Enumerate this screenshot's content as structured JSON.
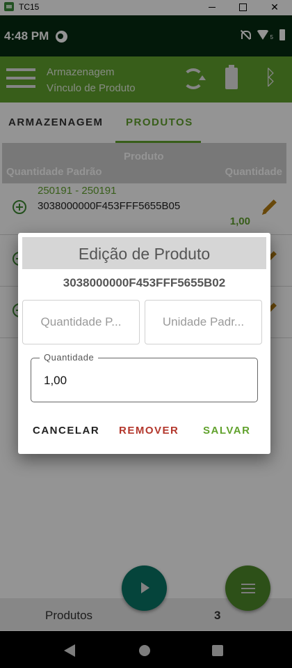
{
  "window": {
    "title": "TC15",
    "close_glyph": "✕"
  },
  "status": {
    "time": "4:48 PM",
    "wifi_badge": "5"
  },
  "toolbar": {
    "title": "Armazenagem",
    "subtitle": "Vínculo de Produto",
    "icons": [
      "menu-icon",
      "sync-icon",
      "battery-icon",
      "bluetooth-icon"
    ],
    "bluetooth_glyph": "ᛒ",
    "color": "#61a22d"
  },
  "tabs": [
    {
      "label": "ARMAZENAGEM",
      "selected": false
    },
    {
      "label": "PRODUTOS",
      "selected": true
    }
  ],
  "table": {
    "headers": {
      "produto": "Produto",
      "qtd_padrao": "Quantidade Padrão",
      "quantidade": "Quantidade"
    },
    "rows": [
      {
        "code": "250191 - 250191",
        "tag": "3038000000F453FFF5655B05",
        "quantity": "1,00"
      },
      {
        "code": "",
        "tag": "",
        "quantity": ""
      },
      {
        "code": "",
        "tag": "",
        "quantity": ""
      }
    ]
  },
  "footer": {
    "label": "Produtos",
    "count": "3"
  },
  "dialog": {
    "title": "Edição de Produto",
    "tag": "3038000000F453FFF5655B02",
    "qtd_padrao_placeholder": "Quantidade P...",
    "unidade_padrao_placeholder": "Unidade Padr...",
    "quantity_label": "Quantidade",
    "quantity_value": "1,00",
    "buttons": {
      "cancel": "CANCELAR",
      "remove": "REMOVER",
      "save": "SALVAR"
    }
  },
  "colors": {
    "accent": "#61a22d",
    "remove": "#b3372c",
    "fab_play": "#0a7566",
    "fab_menu": "#4f8a2a",
    "status_bar": "#062c12"
  }
}
